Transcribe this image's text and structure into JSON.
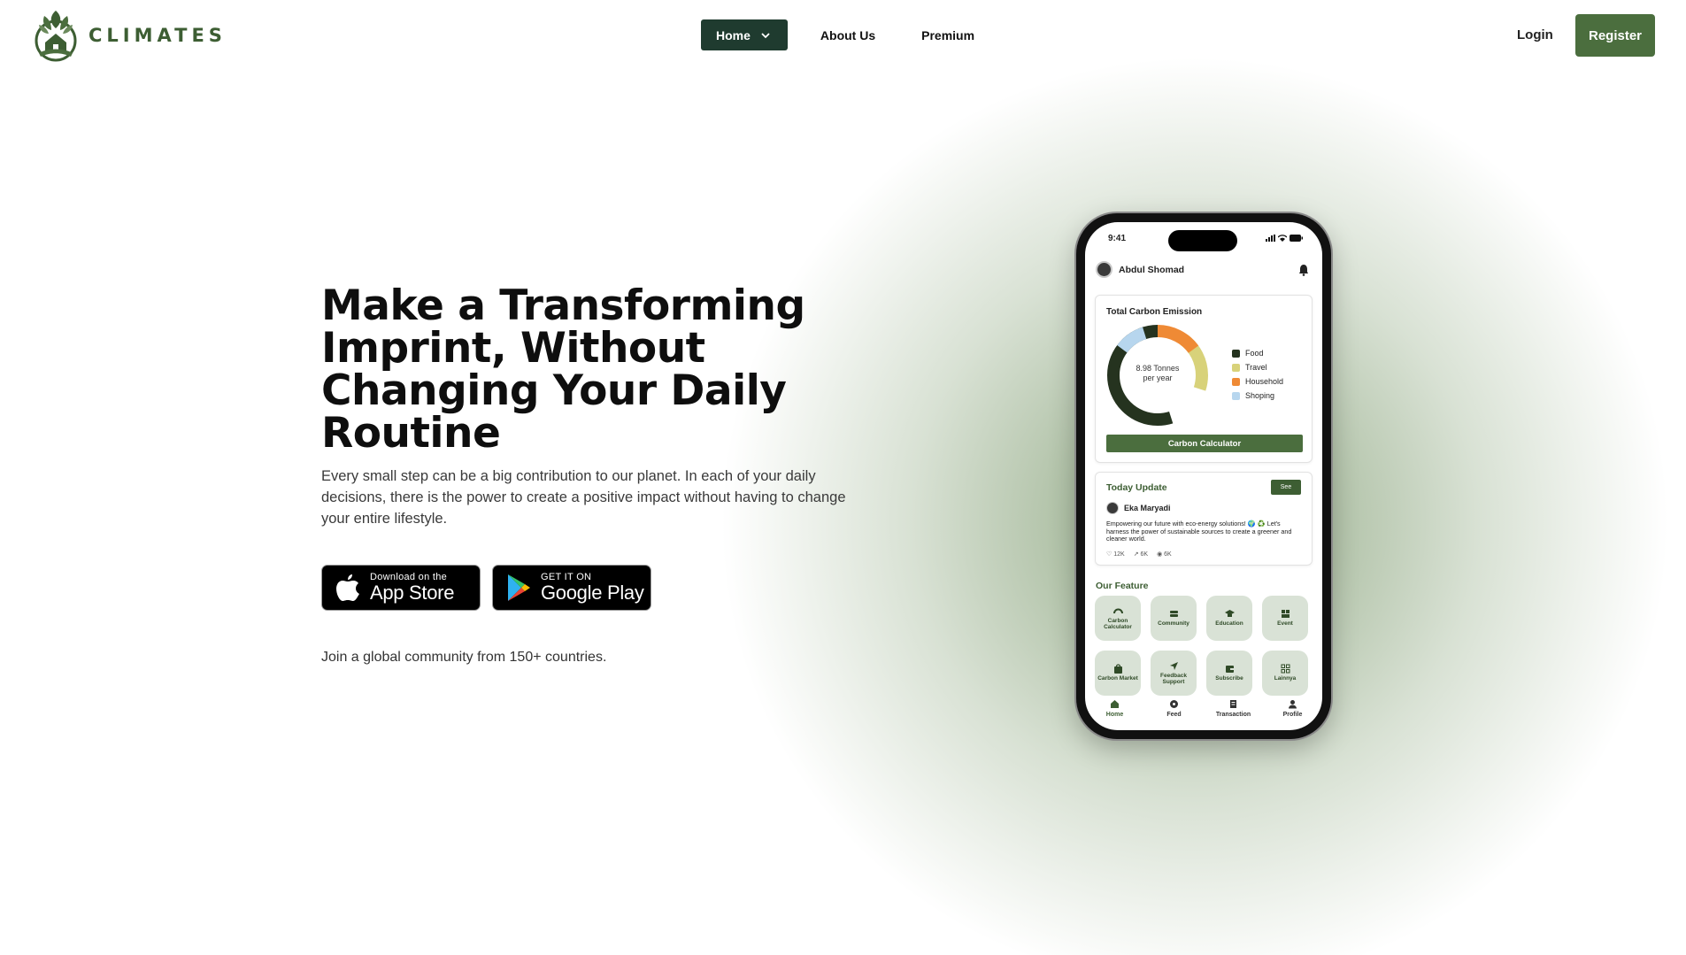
{
  "brand": {
    "name": "CLIMATES",
    "accent": "#4b6e3e",
    "dark": "#1f3b2f"
  },
  "nav": {
    "home_label": "Home",
    "about_label": "About Us",
    "premium_label": "Premium",
    "login_label": "Login",
    "register_label": "Register"
  },
  "hero": {
    "title": "Make a Transforming Imprint, Without Changing Your Daily Routine",
    "description": "Every small step can be a big contribution to our planet. In each of your daily decisions, there is the power to create a positive impact without having to change your entire lifestyle.",
    "join_text": "Join a global community from 150+ countries."
  },
  "stores": {
    "apple_small": "Download on the",
    "apple_big": "App Store",
    "google_small": "GET IT ON",
    "google_big": "Google Play"
  },
  "phone": {
    "time": "9:41",
    "user_name": "Abdul Shomad",
    "emission": {
      "title": "Total Carbon Emission",
      "center_value": "8.98 Tonnes",
      "center_unit": "per year",
      "button_label": "Carbon Calculator",
      "legend": [
        {
          "label": "Food",
          "color": "#25331f"
        },
        {
          "label": "Travel",
          "color": "#d8d27a"
        },
        {
          "label": "Household",
          "color": "#ef8a35"
        },
        {
          "label": "Shoping",
          "color": "#b7d6ee"
        }
      ]
    },
    "update": {
      "title": "Today Update",
      "see_label": "See",
      "poster_name": "Eka Maryadi",
      "post_text": "Empowering our future with eco-energy solutions! 🌍 ♻️ Let's harness the power of sustainable sources to create a greener and cleaner world.",
      "likes": "12K",
      "shares": "6K",
      "comments": "6K"
    },
    "features_title": "Our Feature",
    "features": [
      {
        "label": "Carbon Calculator",
        "icon": "gauge-icon"
      },
      {
        "label": "Community",
        "icon": "community-icon"
      },
      {
        "label": "Education",
        "icon": "graduation-cap-icon"
      },
      {
        "label": "Event",
        "icon": "event-icon"
      },
      {
        "label": "Carbon Market",
        "icon": "bag-icon"
      },
      {
        "label": "Feedback Support",
        "icon": "send-icon"
      },
      {
        "label": "Subscribe",
        "icon": "wallet-icon"
      },
      {
        "label": "Lainnya",
        "icon": "grid-icon"
      }
    ],
    "tabs": [
      {
        "label": "Home",
        "icon": "home-icon"
      },
      {
        "label": "Feed",
        "icon": "chat-icon"
      },
      {
        "label": "Transaction",
        "icon": "receipt-icon"
      },
      {
        "label": "Profile",
        "icon": "user-icon"
      }
    ]
  }
}
